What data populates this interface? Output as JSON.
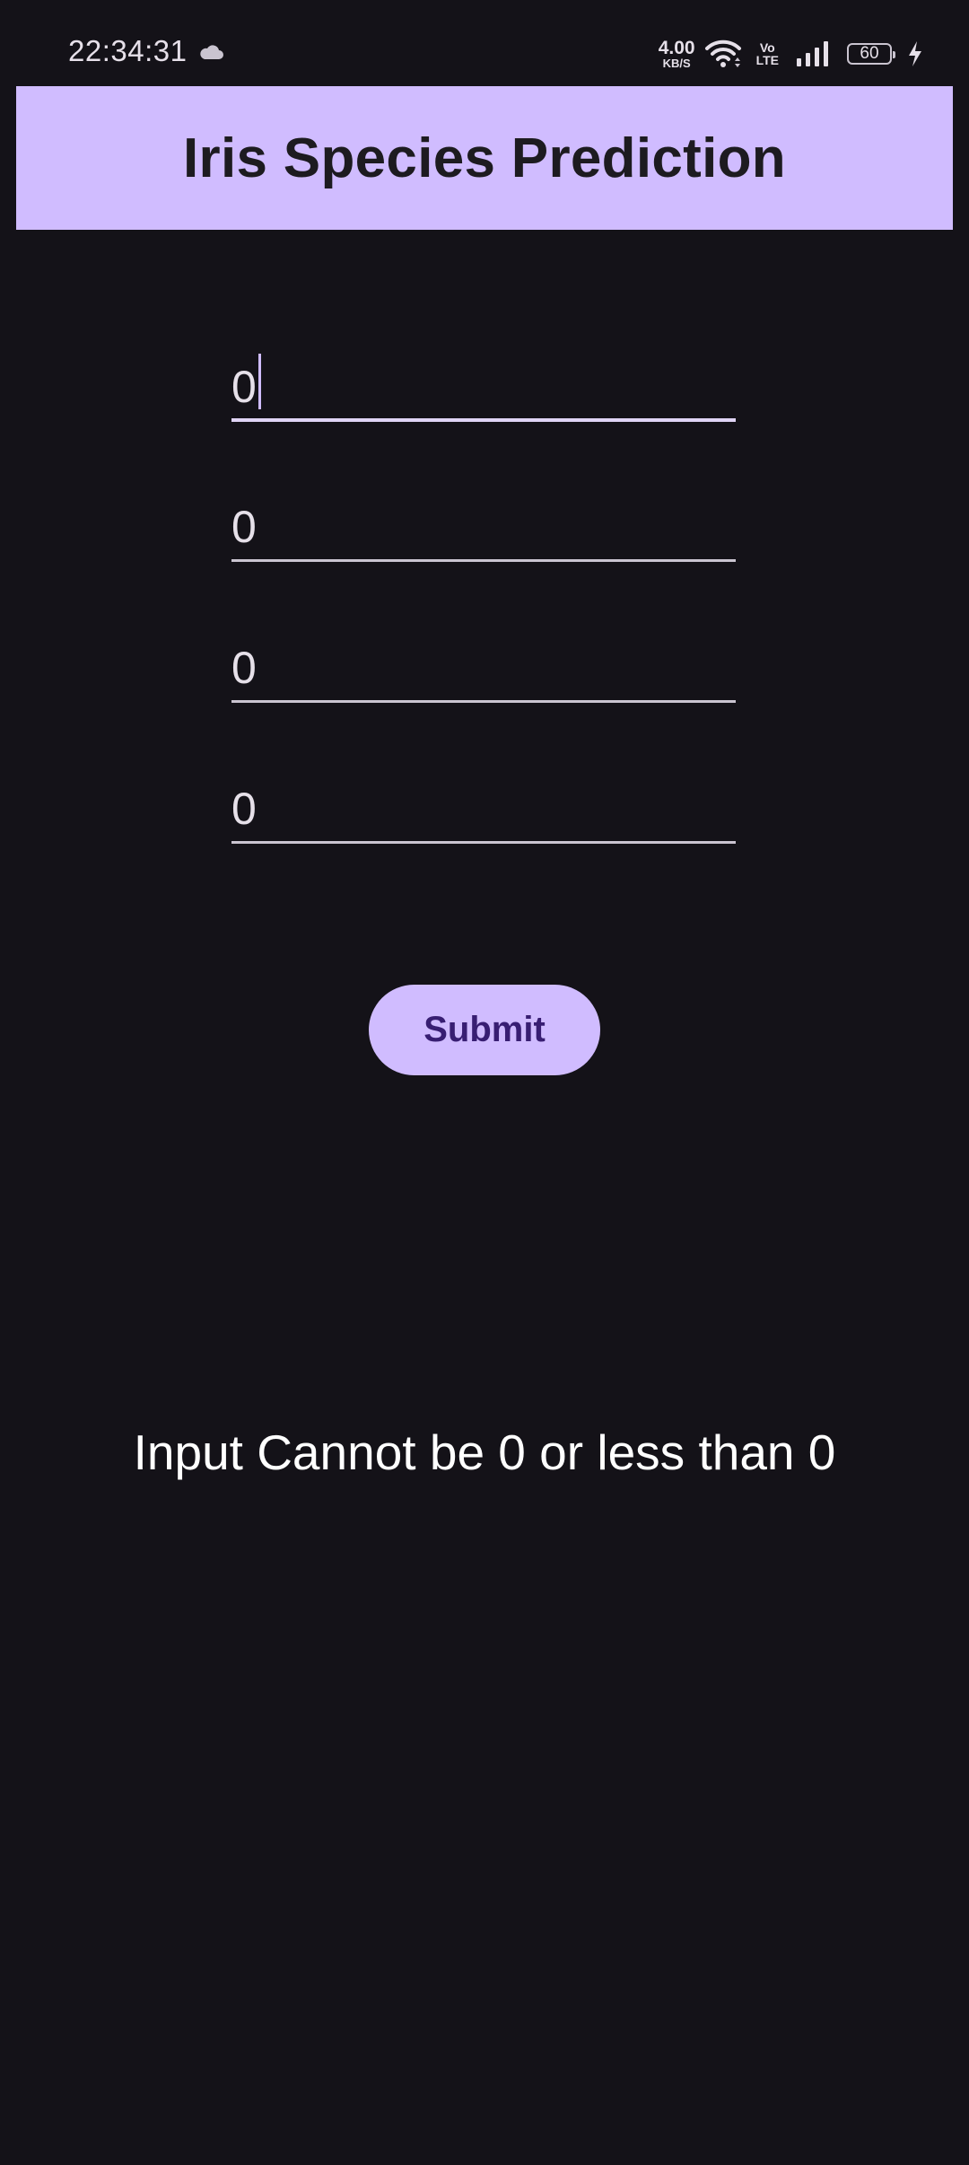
{
  "status_bar": {
    "time": "22:34:31",
    "net_speed_value": "4.00",
    "net_speed_unit": "KB/S",
    "volte_top": "Vo",
    "volte_bottom": "LTE",
    "battery_level": "60",
    "icons": [
      "cloud-icon",
      "wifi-icon",
      "signal-icon",
      "charging-bolt-icon"
    ]
  },
  "app_bar": {
    "title": "Iris Species Prediction"
  },
  "form": {
    "fields": [
      {
        "value": "0",
        "focused": true
      },
      {
        "value": "0",
        "focused": false
      },
      {
        "value": "0",
        "focused": false
      },
      {
        "value": "0",
        "focused": false
      }
    ],
    "submit_label": "Submit"
  },
  "result": {
    "message": "Input Cannot be 0 or less than 0"
  },
  "colors": {
    "background": "#141218",
    "accent": "#d0bcff",
    "on_accent": "#381e72",
    "title_text": "#1d1b20",
    "text": "#e6e0e9"
  }
}
